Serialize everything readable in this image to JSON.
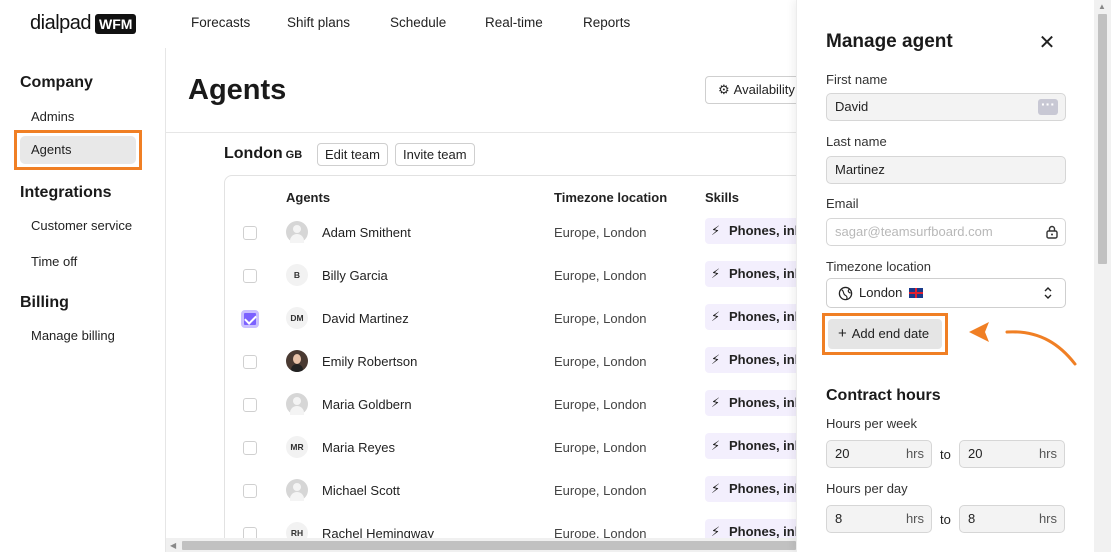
{
  "brand": {
    "wordmark": "dialpad",
    "badge": "WFM"
  },
  "topnav": [
    "Forecasts",
    "Shift plans",
    "Schedule",
    "Real-time",
    "Reports"
  ],
  "sidebar": {
    "company_heading": "Company",
    "admins": "Admins",
    "agents": "Agents",
    "integrations_heading": "Integrations",
    "customer_service": "Customer service",
    "time_off": "Time off",
    "billing_heading": "Billing",
    "manage_billing": "Manage billing"
  },
  "main": {
    "title": "Agents",
    "availability_button": "Availability",
    "team": {
      "name": "London",
      "code": "GB",
      "edit_button": "Edit team",
      "invite_button": "Invite team"
    },
    "table": {
      "headers": {
        "agents": "Agents",
        "timezone": "Timezone location",
        "skills": "Skills"
      },
      "rows": [
        {
          "name": "Adam Smithent",
          "initials": "",
          "tz": "Europe, London",
          "skill": "Phones, inbound",
          "checked": false
        },
        {
          "name": "Billy Garcia",
          "initials": "B",
          "tz": "Europe, London",
          "skill": "Phones, inbound",
          "checked": false
        },
        {
          "name": "David Martinez",
          "initials": "DM",
          "tz": "Europe, London",
          "skill": "Phones, inbound",
          "checked": true
        },
        {
          "name": "Emily Robertson",
          "initials": "",
          "tz": "Europe, London",
          "skill": "Phones, inbound",
          "checked": false
        },
        {
          "name": "Maria Goldbern",
          "initials": "",
          "tz": "Europe, London",
          "skill": "Phones, inbound",
          "checked": false
        },
        {
          "name": "Maria Reyes",
          "initials": "MR",
          "tz": "Europe, London",
          "skill": "Phones, inbound",
          "checked": false
        },
        {
          "name": "Michael Scott",
          "initials": "",
          "tz": "Europe, London",
          "skill": "Phones, inbound",
          "checked": false
        },
        {
          "name": "Rachel Hemingway",
          "initials": "RH",
          "tz": "Europe, London",
          "skill": "Phones, inbound",
          "checked": false
        }
      ]
    }
  },
  "panel": {
    "title": "Manage agent",
    "close_icon": "close-icon",
    "first_name_label": "First name",
    "first_name": "David",
    "last_name_label": "Last name",
    "last_name": "Martinez",
    "email_label": "Email",
    "email_placeholder": "sagar@teamsurfboard.com",
    "timezone_label": "Timezone location",
    "timezone_value": "London",
    "add_end_date": "Add end date",
    "contract_heading": "Contract hours",
    "hours_per_week_label": "Hours per week",
    "week_min": "20",
    "week_max": "20",
    "hours_per_day_label": "Hours per day",
    "day_min": "8",
    "day_max": "8",
    "unit": "hrs",
    "to": "to"
  },
  "colors": {
    "highlight": "#f07f24",
    "accent": "#7b61ff",
    "skill_bg": "#f3effd"
  }
}
